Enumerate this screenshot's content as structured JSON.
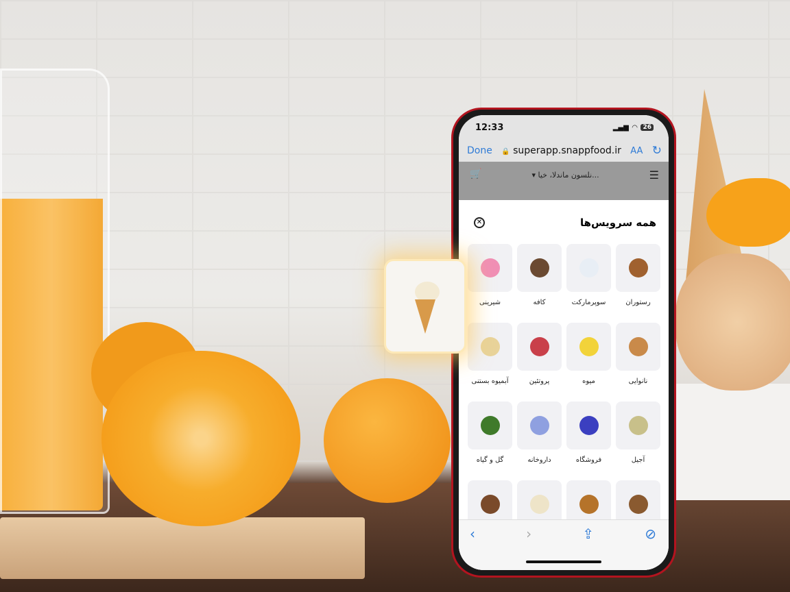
{
  "status_bar": {
    "time": "12:33",
    "battery": "26"
  },
  "browser": {
    "done": "Done",
    "url": "superapp.snappfood.ir",
    "text_size": "AA",
    "reload_icon": "↻",
    "lock_icon": "🔒"
  },
  "app_header": {
    "address": "نلسون ماندلا، خیا...",
    "dropdown": "▾",
    "cart_icon": "🛒",
    "menu_icon": "☰"
  },
  "sheet": {
    "title": "همه سرویس‌ها",
    "close": "✕",
    "services": [
      {
        "label": "رستوران",
        "color": "#a0612f"
      },
      {
        "label": "سوپرمارکت",
        "color": "#e8eef5"
      },
      {
        "label": "کافه",
        "color": "#6b4a32"
      },
      {
        "label": "شیرینی",
        "color": "#f08fb5"
      },
      {
        "label": "نانوایی",
        "color": "#c98a4a"
      },
      {
        "label": "میوه",
        "color": "#f2d33a"
      },
      {
        "label": "پروتئین",
        "color": "#c9404a"
      },
      {
        "label": "آبمیوه بستنی",
        "color": "#e8d39a"
      },
      {
        "label": "آجیل",
        "color": "#c8c08a"
      },
      {
        "label": "فروشگاه",
        "color": "#3b3fc0"
      },
      {
        "label": "داروخانه",
        "color": "#8fa0e0"
      },
      {
        "label": "گل و گیاه",
        "color": "#3f7a2a"
      },
      {
        "label": "",
        "color": "#8a5a30"
      },
      {
        "label": "",
        "color": "#b5732a"
      },
      {
        "label": "",
        "color": "#eee4c8"
      },
      {
        "label": "",
        "color": "#7a4a2a"
      }
    ]
  },
  "toolbar": {
    "back": "‹",
    "forward": "›",
    "share": "⇪",
    "compass": "⊘"
  }
}
